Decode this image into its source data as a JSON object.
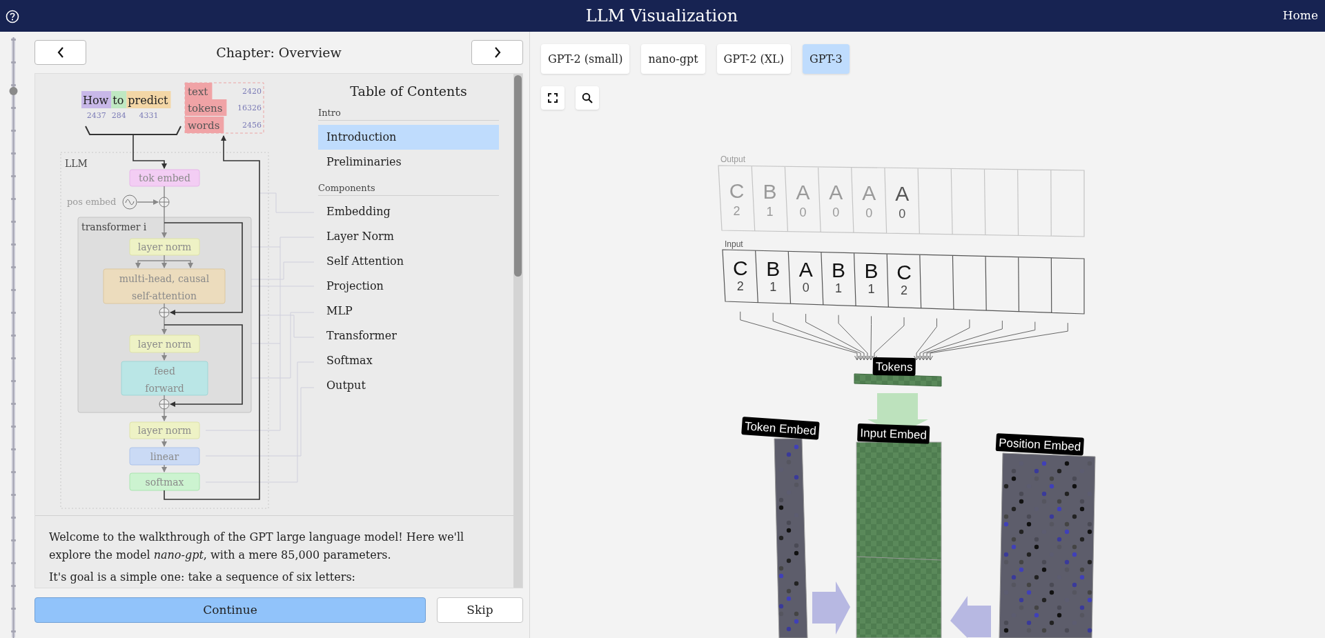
{
  "header": {
    "title": "LLM Visualization",
    "home_link": "Home"
  },
  "chapter": {
    "title": "Chapter: Overview"
  },
  "diagram": {
    "input_words": [
      {
        "text": "How",
        "token_id": "2437",
        "color": "#c8b8e8"
      },
      {
        "text": "to",
        "token_id": "284",
        "color": "#bfe8c2"
      },
      {
        "text": "predict",
        "token_id": "4331",
        "color": "#f3d6a6"
      }
    ],
    "outputs": [
      {
        "text": "text",
        "score": "2420"
      },
      {
        "text": "tokens",
        "score": "16326"
      },
      {
        "text": "words",
        "score": "2456"
      }
    ],
    "llm_label": "LLM",
    "pos_embed_label": "pos embed",
    "transformer_label": "transformer i",
    "blocks": [
      {
        "kind": "tok_embed",
        "lines": [
          "tok embed"
        ]
      },
      {
        "kind": "layer_norm",
        "lines": [
          "layer norm"
        ]
      },
      {
        "kind": "attention",
        "lines": [
          "multi-head, causal",
          "self-attention"
        ]
      },
      {
        "kind": "layer_norm",
        "lines": [
          "layer norm"
        ]
      },
      {
        "kind": "feed_forward",
        "lines": [
          "feed",
          "forward"
        ]
      },
      {
        "kind": "layer_norm",
        "lines": [
          "layer norm"
        ]
      },
      {
        "kind": "linear",
        "lines": [
          "linear"
        ]
      },
      {
        "kind": "softmax",
        "lines": [
          "softmax"
        ]
      }
    ]
  },
  "toc": {
    "title": "Table of Contents",
    "groups": [
      {
        "label": "Intro",
        "items": [
          {
            "text": "Introduction",
            "selected": true
          },
          {
            "text": "Preliminaries",
            "selected": false
          }
        ]
      },
      {
        "label": "Components",
        "items": [
          {
            "text": "Embedding",
            "selected": false
          },
          {
            "text": "Layer Norm",
            "selected": false
          },
          {
            "text": "Self Attention",
            "selected": false
          },
          {
            "text": "Projection",
            "selected": false
          },
          {
            "text": "MLP",
            "selected": false
          },
          {
            "text": "Transformer",
            "selected": false
          },
          {
            "text": "Softmax",
            "selected": false
          },
          {
            "text": "Output",
            "selected": false
          }
        ]
      }
    ]
  },
  "intro": {
    "paragraphs": [
      "Welcome to the walkthrough of the GPT large language model! Here we'll explore the model *nano-gpt*, with a mere 85,000 parameters.",
      "It's goal is a simple one: take a sequence of six letters:"
    ]
  },
  "continue_button": "Continue",
  "skip_button": "Skip",
  "models": [
    {
      "label": "GPT-2 (small)",
      "selected": false
    },
    {
      "label": "nano-gpt",
      "selected": false
    },
    {
      "label": "GPT-2 (XL)",
      "selected": false
    },
    {
      "label": "GPT-3",
      "selected": true
    }
  ],
  "scene": {
    "output_label": "Output",
    "output_tokens": [
      {
        "letter": "C",
        "index": "2",
        "faded": true
      },
      {
        "letter": "B",
        "index": "1",
        "faded": true
      },
      {
        "letter": "A",
        "index": "0",
        "faded": true
      },
      {
        "letter": "A",
        "index": "0",
        "faded": true
      },
      {
        "letter": "A",
        "index": "0",
        "faded": true
      },
      {
        "letter": "A",
        "index": "0",
        "faded": false
      }
    ],
    "input_label": "Input",
    "input_tokens": [
      {
        "letter": "C",
        "index": "2"
      },
      {
        "letter": "B",
        "index": "1"
      },
      {
        "letter": "A",
        "index": "0"
      },
      {
        "letter": "B",
        "index": "1"
      },
      {
        "letter": "B",
        "index": "1"
      },
      {
        "letter": "C",
        "index": "2"
      }
    ],
    "tokens_label": "Tokens",
    "columns": [
      {
        "kind": "token_embed",
        "label": "Token Embed"
      },
      {
        "kind": "input_embed",
        "label": "Input Embed"
      },
      {
        "kind": "position_embed",
        "label": "Position Embed"
      }
    ]
  }
}
